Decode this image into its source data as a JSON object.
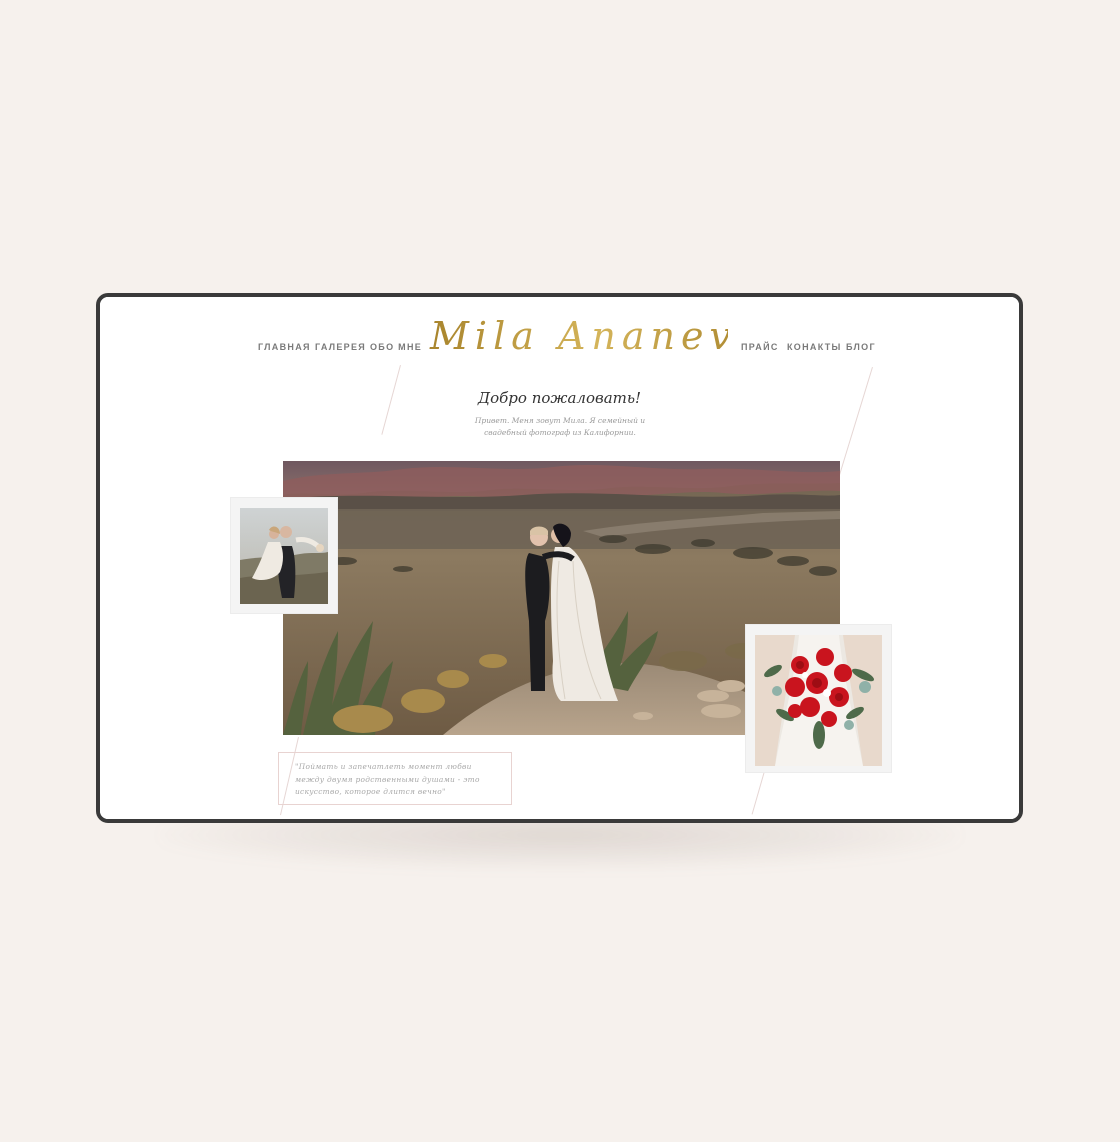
{
  "site": {
    "logo_text": "Mila Ananeva",
    "brand_color": "#b9993e",
    "accent_line_color": "#e6d6d4"
  },
  "nav": {
    "left": [
      {
        "label": "ГЛАВНАЯ"
      },
      {
        "label": "ГАЛЕРЕЯ"
      },
      {
        "label": "ОБО МНЕ"
      }
    ],
    "right": [
      {
        "label": "ПРАЙС"
      },
      {
        "label": "КОНАКТЫ"
      },
      {
        "label": "БЛОГ"
      }
    ]
  },
  "welcome": {
    "title": "Добро пожаловать!",
    "text": "Привет. Меня зовут Мила. Я семейный и свадебный фотограф из Калифорнии."
  },
  "quote": {
    "text": "\"Поймать и запечатлеть момент любви между двумя родственными душами - это искусство, которое длится вечно\""
  },
  "images": {
    "hero": "wedding-couple-kissing-in-desert-photo",
    "left_polaroid": "couple-piggyback-photo",
    "right_polaroid": "red-bridal-bouquet-photo"
  }
}
